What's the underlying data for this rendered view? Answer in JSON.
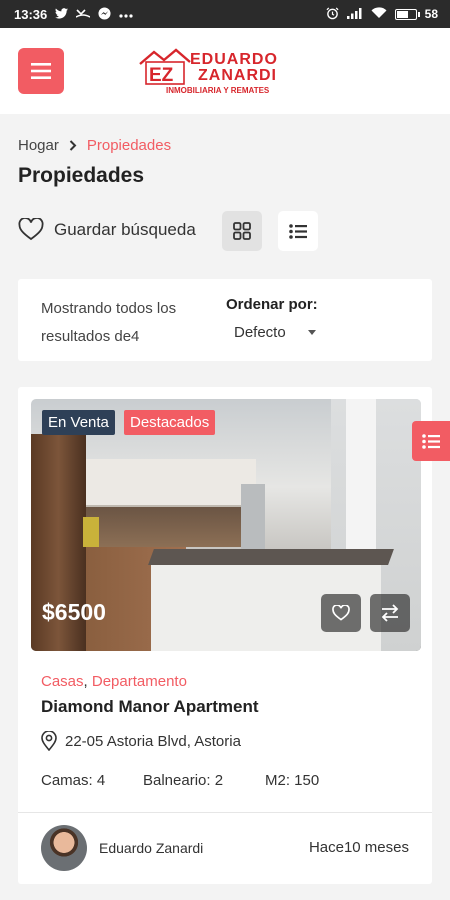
{
  "status_bar": {
    "time": "13:36",
    "battery": "58"
  },
  "header": {
    "logo": {
      "initials": "EZ",
      "line1": "EDUARDO",
      "line2": "ZANARDI",
      "tagline": "INMOBILIARIA Y REMATES"
    }
  },
  "breadcrumb": {
    "home": "Hogar",
    "current": "Propiedades"
  },
  "page_title": "Propiedades",
  "save_search": {
    "label": "Guardar búsqueda"
  },
  "results": {
    "text": "Mostrando todos los resultados de4",
    "sort_label": "Ordenar por:",
    "sort_value": "Defecto"
  },
  "listing": {
    "status_badge": "En Venta",
    "featured_badge": "Destacados",
    "price": "$6500",
    "categories": [
      "Casas",
      "Departamento"
    ],
    "category_separator": ",",
    "title": "Diamond Manor Apartment",
    "address": "22-05 Astoria Blvd, Astoria",
    "features": {
      "beds": "Camas: 4",
      "baths": "Balneario: 2",
      "area": "M2: 150"
    },
    "agent_name": "Eduardo Zanardi",
    "time_ago": "Hace10 meses"
  },
  "colors": {
    "accent": "#f25c63",
    "badge_dark": "#2e4057",
    "logo_red": "#d7262c"
  }
}
